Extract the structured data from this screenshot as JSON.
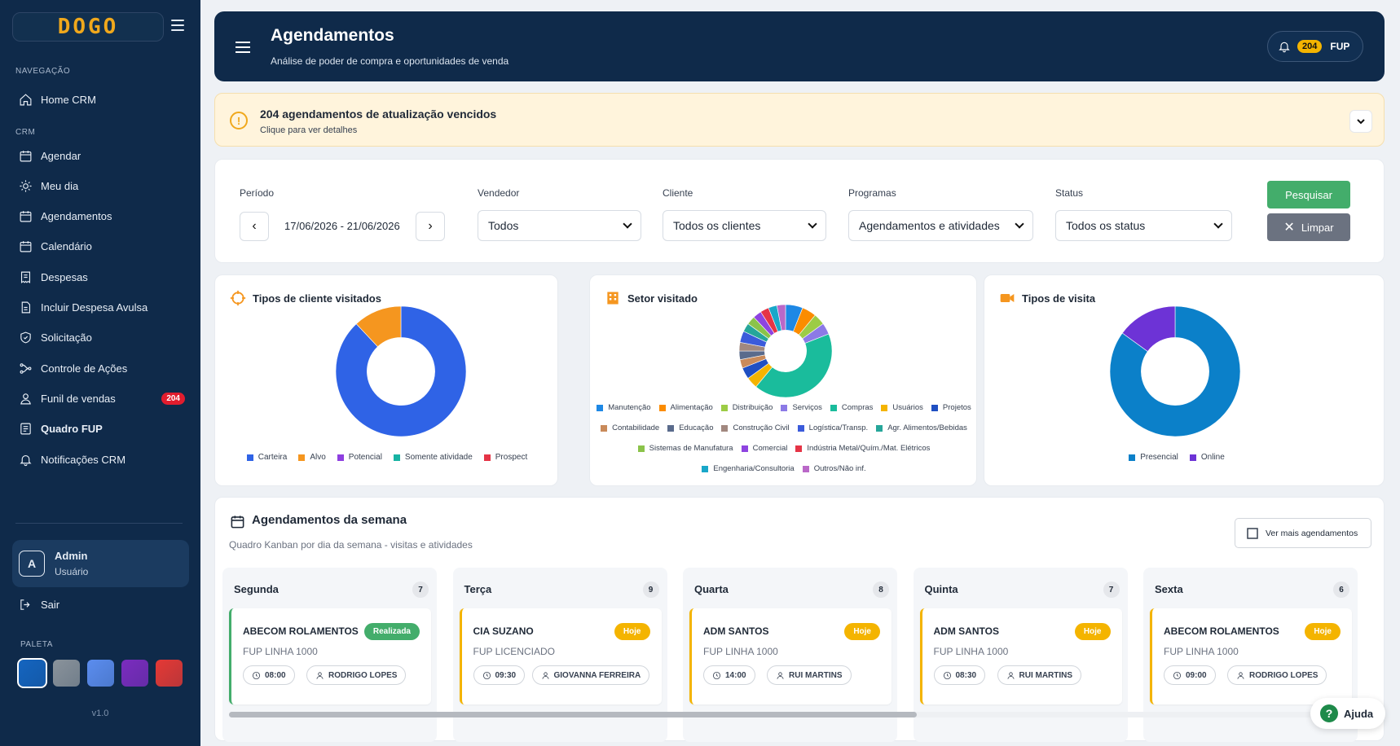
{
  "sidebar": {
    "logo": "DOGO",
    "section_nav": "NAVEGAÇÃO",
    "section_crm": "CRM",
    "home": "Home CRM",
    "items": [
      {
        "label": "Agendar",
        "icon": "calendar-icon"
      },
      {
        "label": "Meu dia",
        "icon": "sun-icon"
      },
      {
        "label": "Agendamentos",
        "icon": "calendar-icon"
      },
      {
        "label": "Calendário",
        "icon": "calendar-icon"
      },
      {
        "label": "Despesas",
        "icon": "receipt-icon"
      },
      {
        "label": "Incluir Despesa Avulsa",
        "icon": "document-icon"
      },
      {
        "label": "Solicitação",
        "icon": "shield-icon"
      },
      {
        "label": "Controle de Ações",
        "icon": "flow-icon"
      },
      {
        "label": "Funil de vendas",
        "icon": "user-icon",
        "badge": "204"
      },
      {
        "label": "Quadro FUP",
        "icon": "board-icon"
      },
      {
        "label": "Notificações CRM",
        "icon": "bell-icon"
      }
    ],
    "user": {
      "initial": "A",
      "name": "Admin",
      "role": "Usuário"
    },
    "logout": "Sair",
    "palette_label": "PALETA",
    "palette": [
      "#1565c0",
      "#8a939b",
      "#5b8def",
      "#7b2cbf",
      "#e53935"
    ],
    "version": "v1.0"
  },
  "header": {
    "title": "Agendamentos",
    "subtitle": "Análise de poder de compra e oportunidades de venda",
    "notif_count": "204",
    "fup": "FUP"
  },
  "alert": {
    "title": "204 agendamentos de atualização vencidos",
    "subtitle": "Clique para ver detalhes"
  },
  "filters": {
    "periodo_label": "Período",
    "periodo_value": "17/06/2026 - 21/06/2026",
    "vendedor_label": "Vendedor",
    "vendedor_value": "Todos",
    "cliente_label": "Cliente",
    "cliente_value": "Todos os clientes",
    "programas_label": "Programas",
    "programas_value": "Agendamentos e atividades",
    "status_label": "Status",
    "status_value": "Todos os status",
    "search_btn": "Pesquisar",
    "clear_btn": "Limpar"
  },
  "chart_data": [
    {
      "type": "pie",
      "title": "Tipos de cliente visitados",
      "categories": [
        "Carteira",
        "Alvo",
        "Potencial",
        "Somente atividade",
        "Prospect"
      ],
      "values": [
        88,
        12,
        0,
        0,
        0
      ],
      "colors": [
        "#2f63e6",
        "#f5961f",
        "#8e3fe0",
        "#17b3a3",
        "#e53446"
      ]
    },
    {
      "type": "pie",
      "title": "Setor visitado",
      "categories": [
        "Manutenção",
        "Alimentação",
        "Distribuição",
        "Serviços",
        "Compras",
        "Usuários",
        "Projetos",
        "Contabilidade",
        "Educação",
        "Construção Civil",
        "Logística/Transp.",
        "Agr. Alimentos/Bebidas",
        "Sistemas de Manufatura",
        "Comercial",
        "Indústria Metal/Quím./Mat. Elétricos",
        "Engenharia/Consultoria",
        "Outros/Não inf."
      ],
      "values": [
        6,
        5,
        4,
        4,
        42,
        4,
        4,
        3,
        3,
        3,
        4,
        3,
        3,
        3,
        3,
        3,
        3
      ],
      "colors": [
        "#1e88e5",
        "#fb8c00",
        "#9ccc45",
        "#8c7ae6",
        "#1abc9c",
        "#f4b400",
        "#1f4fc2",
        "#c98a5a",
        "#5a6b8c",
        "#a1887f",
        "#3b5bdb",
        "#26a69a",
        "#8bc34a",
        "#8e44e0",
        "#e53446",
        "#19a7c9",
        "#ba68c8"
      ]
    },
    {
      "type": "pie",
      "title": "Tipos de visita",
      "categories": [
        "Presencial",
        "Online"
      ],
      "values": [
        85,
        15
      ],
      "colors": [
        "#0b80c9",
        "#6d33d6"
      ]
    }
  ],
  "week": {
    "title": "Agendamentos da semana",
    "subtitle": "Quadro Kanban por dia da semana - visitas e atividades",
    "more_btn": "Ver mais agendamentos",
    "columns": [
      {
        "day": "Segunda",
        "count": "7",
        "client": "ABECOM ROLAMENTOS",
        "badge": "Realizada",
        "program": "FUP LINHA 1000",
        "time": "08:00",
        "seller": "RODRIGO LOPES"
      },
      {
        "day": "Terça",
        "count": "9",
        "client": "CIA SUZANO",
        "badge": "Hoje",
        "program": "FUP LICENCIADO",
        "time": "09:30",
        "seller": "GIOVANNA FERREIRA"
      },
      {
        "day": "Quarta",
        "count": "8",
        "client": "ADM SANTOS",
        "badge": "Hoje",
        "program": "FUP LINHA 1000",
        "time": "14:00",
        "seller": "RUI MARTINS"
      },
      {
        "day": "Quinta",
        "count": "7",
        "client": "ADM SANTOS",
        "badge": "Hoje",
        "program": "FUP LINHA 1000",
        "time": "08:30",
        "seller": "RUI MARTINS"
      },
      {
        "day": "Sexta",
        "count": "6",
        "client": "ABECOM ROLAMENTOS",
        "badge": "Hoje",
        "program": "FUP LINHA 1000",
        "time": "09:00",
        "seller": "RODRIGO LOPES"
      }
    ]
  },
  "help": "Ajuda"
}
